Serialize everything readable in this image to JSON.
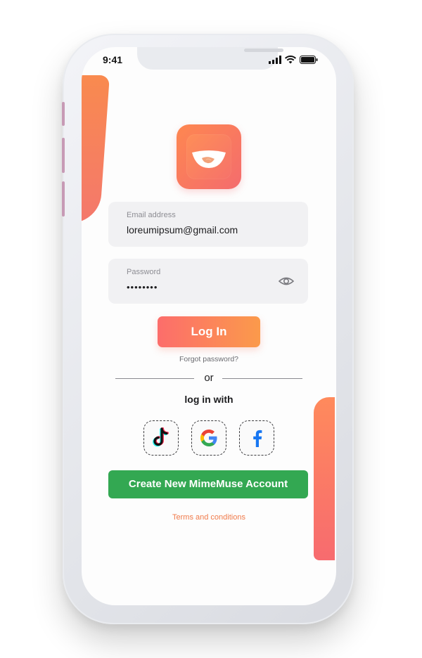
{
  "status_bar": {
    "time": "9:41"
  },
  "login_form": {
    "email": {
      "label": "Email address",
      "value": "loreumipsum@gmail.com"
    },
    "password": {
      "label": "Password",
      "value": "••••••••"
    },
    "login_button_label": "Log In",
    "forgot_password_label": "Forgot password?",
    "divider_label": "or",
    "login_with_label": "log in with",
    "social_providers": [
      "tiktok-icon",
      "google-icon",
      "facebook-icon"
    ],
    "create_account_label": "Create New MimeMuse Account",
    "terms_label": "Terms and conditions"
  },
  "colors": {
    "accent_orange": "#fb9a4b",
    "accent_coral": "#fc6d6b",
    "create_button_green": "#33a852",
    "terms_text": "#f07a4a"
  }
}
